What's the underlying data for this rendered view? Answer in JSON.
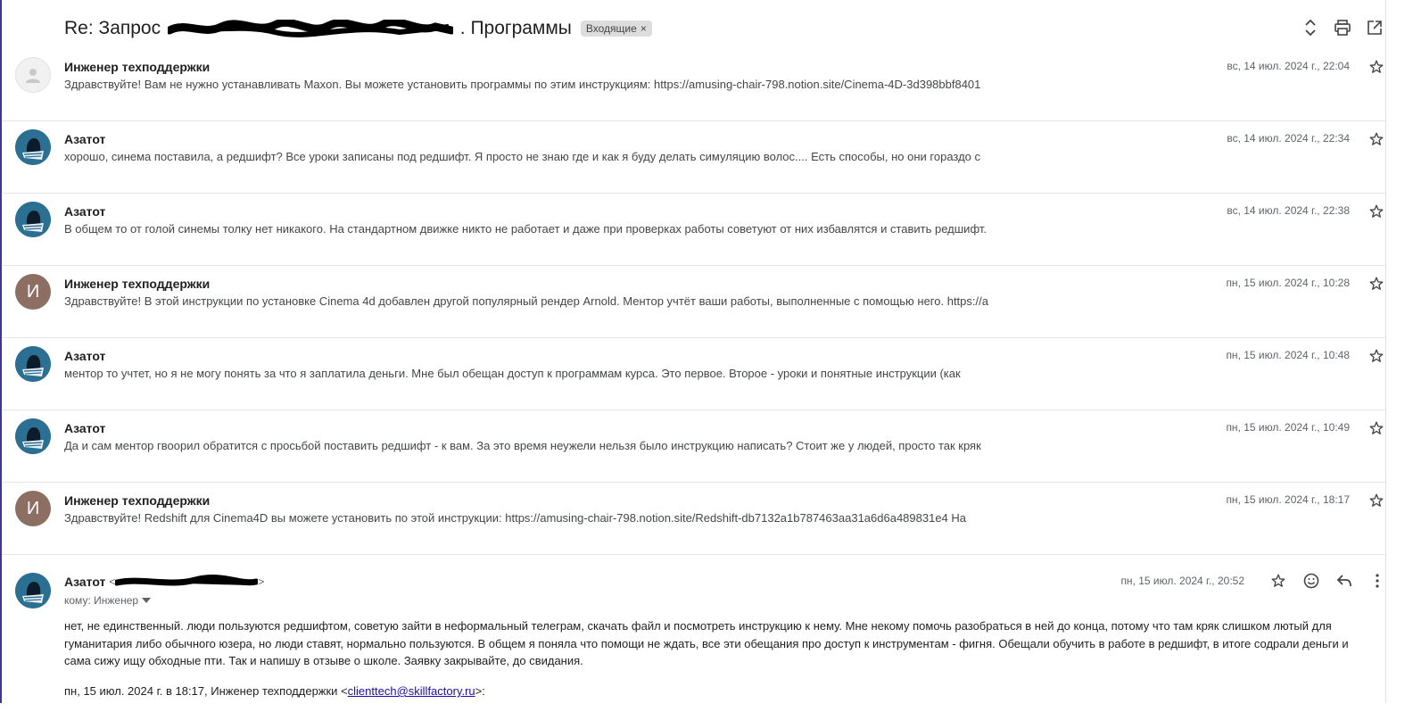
{
  "subject": {
    "prefix": "Re: Запрос",
    "suffix": ". Программы",
    "label": "Входящие",
    "label_close": "×"
  },
  "messages": [
    {
      "sender": "Инженер техподдержки",
      "avatar": "blank",
      "snippet": "Здравствуйте! Вам не нужно устанавливать Maxon. Вы можете установить программы по этим инструкциям: https://amusing-chair-798.notion.site/Cinema-4D-3d398bbf8401",
      "date": "вс, 14 июл. 2024 г., 22:04"
    },
    {
      "sender": "Азатот",
      "avatar": "picture",
      "snippet": "хорошо, синема поставила, а редшифт? Все уроки записаны под редшифт. Я просто не знаю где и как я буду делать симуляцию волос.... Есть способы, но они гораздо с",
      "date": "вс, 14 июл. 2024 г., 22:34"
    },
    {
      "sender": "Азатот",
      "avatar": "picture",
      "snippet": "В общем то от голой синемы толку нет никакого. На стандартном движке никто не работает и даже при проверках работы советуют от них избавлятся и ставить редшифт.",
      "date": "вс, 14 июл. 2024 г., 22:38"
    },
    {
      "sender": "Инженер техподдержки",
      "avatar": "И",
      "snippet": "Здравствуйте! В этой инструкции по установке Cinema 4d добавлен другой популярный рендер Arnold. Ментор учтёт ваши работы, выполненные с помощью него. https://a",
      "date": "пн, 15 июл. 2024 г., 10:28"
    },
    {
      "sender": "Азатот",
      "avatar": "picture",
      "snippet": "ментор то учтет, но я не могу понять за что я заплатила деньги. Мне был обещан доступ к программам курса. Это первое. Второе - уроки и понятные инструкции (как",
      "date": "пн, 15 июл. 2024 г., 10:48"
    },
    {
      "sender": "Азатот",
      "avatar": "picture",
      "snippet": "Да и сам ментор гвоорил обратится с просьбой поставить редшифт - к вам. За это время неужели нельзя было инструкцию написать? Стоит же у людей, просто так кряк",
      "date": "пн, 15 июл. 2024 г., 10:49"
    },
    {
      "sender": "Инженер техподдержки",
      "avatar": "И",
      "snippet": "Здравствуйте! Redshift для Cinema4D вы можете установить по этой инструкции: https://amusing-chair-798.notion.site/Redshift-db7132a1b787463aa31a6d6a489831e4 На",
      "date": "пн, 15 июл. 2024 г., 18:17"
    }
  ],
  "open_message": {
    "sender": "Азатот",
    "email_open": "<",
    "email_close": ">",
    "to": "кому: Инженер",
    "date": "пн, 15 июл. 2024 г., 20:52",
    "body": "нет, не единственный. люди пользуются редшифтом, советую зайти в неформальный телеграм, скачать файл и посмотреть инструкцию к нему. Мне некому помочь разобраться в ней до конца, потому что там кряк слишком лютый для гуманитария либо обычного юзера, но люди ставят, нормально пользуются. В общем я поняла что помощи не ждать, все эти обещания про доступ к инструментам - фигня. Обещали обучить в работе в редшифт, в итоге содрали деньги и сама сижу ищу обходные пти. Так и напишу в отзыве о школе. Заявку закрывайте, до свидания.",
    "quote_prefix": "пн, 15 июл. 2024 г. в 18:17, Инженер техподдержки <",
    "quote_email": "clienttech@skillfactory.ru",
    "quote_suffix": ">:"
  },
  "icons": {
    "expand": "unfold-icon",
    "print": "print-icon",
    "open_new": "open-in-new-icon",
    "star": "star-outline-icon",
    "emoji": "emoji-icon",
    "reply": "reply-icon",
    "more": "more-vert-icon"
  },
  "colors": {
    "link": "#1a0dab",
    "avatar_letter": "#8d6e63",
    "avatar_picture": "#1f5a7a",
    "label_chip": "#dddddd"
  }
}
